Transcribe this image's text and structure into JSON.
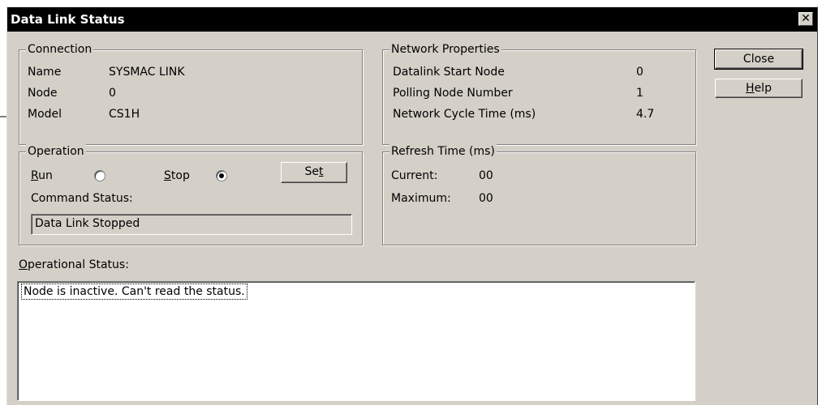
{
  "window": {
    "title": "Data Link Status",
    "close_glyph": "✕"
  },
  "connection": {
    "legend": "Connection",
    "rows": [
      {
        "label": "Name",
        "value": "SYSMAC LINK"
      },
      {
        "label": "Node",
        "value": "0"
      },
      {
        "label": "Model",
        "value": "CS1H"
      }
    ]
  },
  "network": {
    "legend": "Network Properties",
    "rows": [
      {
        "label": "Datalink Start Node",
        "value": "0"
      },
      {
        "label": "Polling Node Number",
        "value": "1"
      },
      {
        "label": "Network Cycle Time (ms)",
        "value": "4.7"
      }
    ]
  },
  "operation": {
    "legend": "Operation",
    "run_key": "R",
    "run_rest": "un",
    "stop_key": "S",
    "stop_rest": "top",
    "run_selected": false,
    "stop_selected": true,
    "set_pre": "Se",
    "set_key": "t",
    "command_status_label": "Command Status:",
    "command_status_value": "Data Link Stopped"
  },
  "refresh": {
    "legend": "Refresh Time (ms)",
    "current_label": "Current:",
    "current_value": "00",
    "maximum_label": "Maximum:",
    "maximum_value": "00"
  },
  "buttons": {
    "close": "Close",
    "help_key": "H",
    "help_rest": "elp"
  },
  "operational_status": {
    "label_key": "O",
    "label_rest": "perational Status:",
    "items": [
      "Node is inactive. Can't read the status."
    ]
  },
  "icons": {
    "radio": "radio-icon",
    "callout": "callout-line"
  }
}
